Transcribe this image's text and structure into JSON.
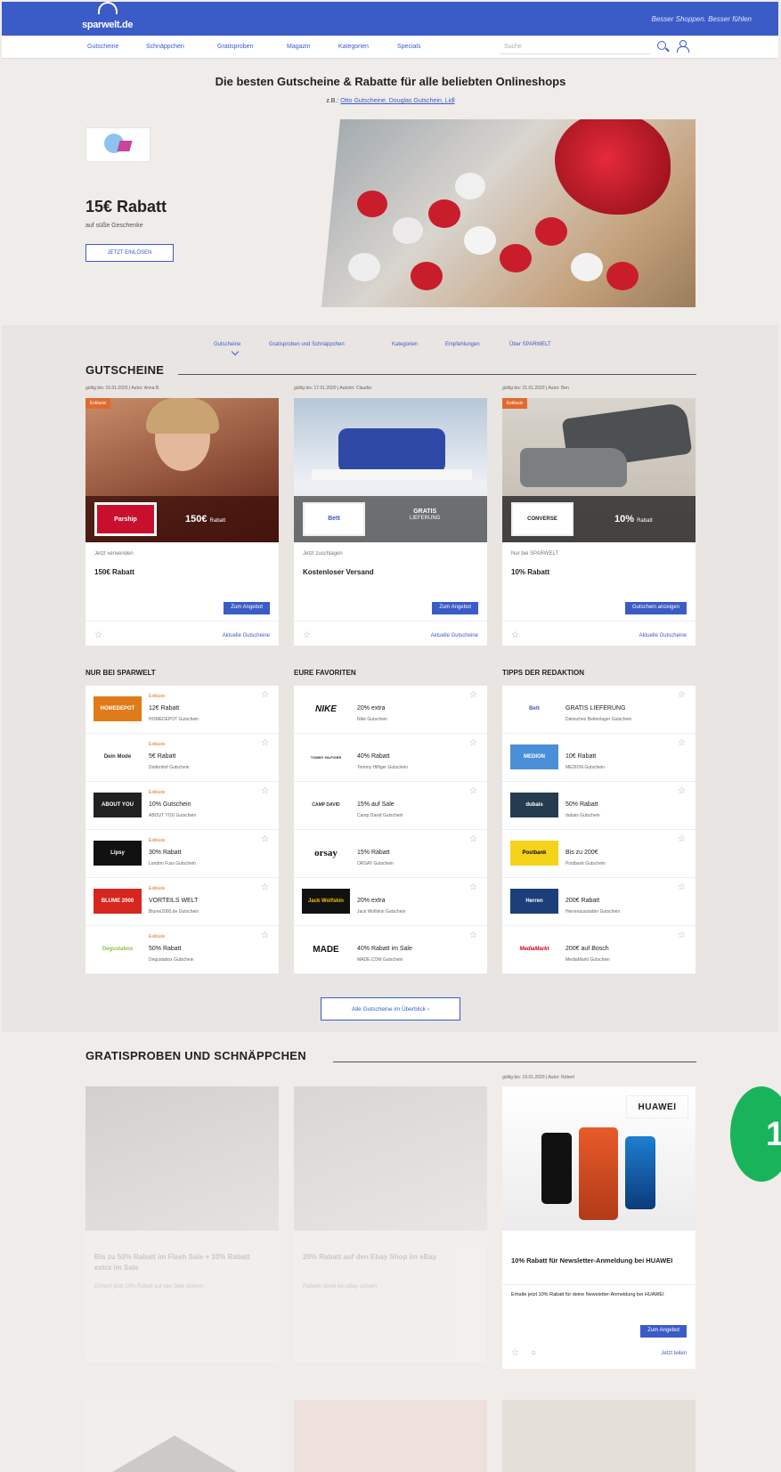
{
  "header": {
    "logo": "sparwelt.de",
    "slogan": "Besser Shoppen. Besser fühlen"
  },
  "nav": {
    "items": [
      "Gutscheine",
      "Schnäppchen",
      "Gratisproben",
      "Magazin",
      "Kategorien",
      "Specials"
    ],
    "search_placeholder": "Suche"
  },
  "hero": {
    "headline": "Die besten Gutscheine & Rabatte für alle beliebten Onlineshops",
    "sublink_prefix": "z.B.:",
    "sublink": "Otto Gutscheine, Douglas Gutschein, Lidl",
    "title": "15€ Rabatt",
    "subtitle": "auf süße Geschenke",
    "button": "JETZT EINLÖSEN"
  },
  "subnav": [
    "Gutscheine",
    "Gratisproben und Schnäppchen",
    "Kategorien",
    "Empfehlungen",
    "Über SPARWELT"
  ],
  "gutscheine": {
    "title": "GUTSCHEINE",
    "cards": [
      {
        "meta": "gültig bis: 15.01.2020 | Autor: Anna B.",
        "tag": "Exklusiv",
        "brand": "Parship",
        "band": "150€",
        "band_small": "Rabatt",
        "sub": "Jetzt verwenden",
        "title": "150€ Rabatt",
        "button": "Zum Angebot",
        "link": "Aktuelle Gutscheine"
      },
      {
        "meta": "gültig bis: 17.01.2020 | Autorin: Claudia",
        "tag": "",
        "brand": "Bett",
        "band": "GRATIS",
        "band_small": "LIEFERUNG",
        "sub": "Jetzt zuschlagen",
        "title": "Kostenloser Versand",
        "button": "Zum Angebot",
        "link": "Aktuelle Gutscheine"
      },
      {
        "meta": "gültig bis: 21.01.2020 | Autor: Ben",
        "tag": "Exklusiv",
        "brand": "CONVERSE",
        "band": "10%",
        "band_small": "Rabatt",
        "sub": "Nur bei SPARWELT",
        "title": "10% Rabatt",
        "button": "Gutschein anzeigen",
        "link": "Aktuelle Gutscheine"
      }
    ]
  },
  "columns": [
    {
      "title": "NUR BEI SPARWELT",
      "items": [
        {
          "logo": "HOMEDEPOT",
          "badge": "Exklusiv",
          "title": "12€ Rabatt",
          "sub": "HOMEDEPOT Gutschein"
        },
        {
          "logo": "Dein Mode",
          "badge": "Exklusiv",
          "title": "5€ Rabatt",
          "sub": "Dodenhof Gutschein"
        },
        {
          "logo": "ABOUT YOU",
          "badge": "Exklusiv",
          "title": "10% Gutschein",
          "sub": "ABOUT YOU Gutschein"
        },
        {
          "logo": "Lipsy",
          "badge": "Exklusiv",
          "title": "30% Rabatt",
          "sub": "London Fuss Gutschein"
        },
        {
          "logo": "BLUME 2000",
          "badge": "Exklusiv",
          "title": "VORTEILS WELT",
          "sub": "Blume2000.de Gutschein"
        },
        {
          "logo": "Degustabox",
          "badge": "Exklusiv",
          "title": "50% Rabatt",
          "sub": "Degustabox Gutschein"
        }
      ]
    },
    {
      "title": "EURE FAVORITEN",
      "items": [
        {
          "logo": "NIKE",
          "badge": "",
          "title": "20% extra",
          "sub": "Nike Gutschein"
        },
        {
          "logo": "TOMMY HILFIGER",
          "badge": "",
          "title": "40% Rabatt",
          "sub": "Tommy Hilfiger Gutschein"
        },
        {
          "logo": "CAMP DAVID",
          "badge": "",
          "title": "15% auf Sale",
          "sub": "Camp David Gutschein"
        },
        {
          "logo": "orsay",
          "badge": "",
          "title": "15% Rabatt",
          "sub": "ORSAY Gutschein"
        },
        {
          "logo": "Jack Wolfskin",
          "badge": "",
          "title": "20% extra",
          "sub": "Jack Wolfskin Gutschein"
        },
        {
          "logo": "MADE",
          "badge": "",
          "title": "40% Rabatt im Sale",
          "sub": "MADE.COM Gutschein"
        }
      ]
    },
    {
      "title": "TIPPS DER REDAKTION",
      "items": [
        {
          "logo": "Bett",
          "badge": "",
          "title": "GRATIS LIEFERUNG",
          "sub": "Dänisches Bettenlager Gutschein"
        },
        {
          "logo": "MEDION",
          "badge": "",
          "title": "10€ Rabatt",
          "sub": "MEDION Gutschein"
        },
        {
          "logo": "dubais",
          "badge": "",
          "title": "50% Rabatt",
          "sub": "dubais Gutschein"
        },
        {
          "logo": "Postbank",
          "badge": "",
          "title": "Bis zu 200€",
          "sub": "Postbank Gutschein"
        },
        {
          "logo": "Herren",
          "badge": "",
          "title": "200€ Rabatt",
          "sub": "Herrenausstatter Gutschein"
        },
        {
          "logo": "MediaMarkt",
          "badge": "",
          "title": "200€ auf Bosch",
          "sub": "MediaMarkt Gutschein"
        }
      ]
    }
  ],
  "overview_button": "Alle Gutscheine im Überblick",
  "gratis": {
    "title": "GRATISPROBEN UND SCHNÄPPCHEN",
    "faded_cards": [
      {
        "title": "Bis zu 50% Rabatt im Flash Sale + 10% Rabatt extra im Sale",
        "sub": "Einfach jetzt 10% Rabatt auf den Sale sichern"
      },
      {
        "title": "20% Rabatt auf den Ebay Shop im eBay",
        "sub": "Rabatte direkt bei eBay sichern"
      }
    ],
    "huawei": {
      "meta": "gültig bis: 19.01.2020 | Autor: Robert",
      "brand": "HUAWEI",
      "title": "10% Rabatt für Newsletter-Anmeldung bei HUAWEI",
      "sub": "Erhalte jetzt 10% Rabatt für deine Newsletter-Anmeldung bei HUAWEI",
      "button": "Zum Angebot",
      "link": "Jetzt teilen"
    },
    "badge": "1"
  },
  "colors": {
    "primary": "#3b5bc6",
    "accent": "#e06b2e",
    "badge": "#19b35b"
  }
}
